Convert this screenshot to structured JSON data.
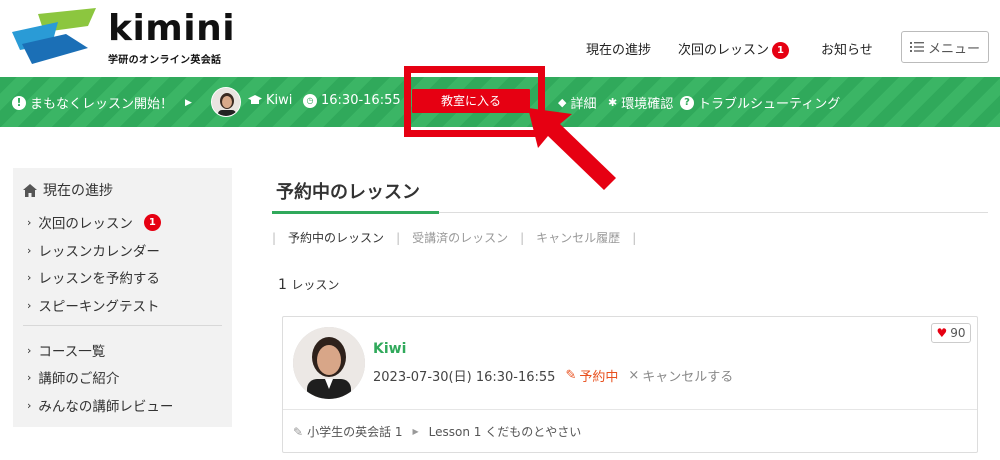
{
  "header": {
    "logo_word": "kimini",
    "logo_sub": "学研のオンライン英会話",
    "nav": [
      {
        "label": "現在の進捗"
      },
      {
        "label": "次回のレッスン",
        "badge": "1"
      },
      {
        "label": "お知らせ"
      }
    ],
    "menu_label": "メニュー"
  },
  "bar": {
    "notice": "まもなくレッスン開始！",
    "teacher": "Kiwi",
    "time": "16:30-16:55",
    "enter_label": "教室に入る",
    "links": [
      "詳細",
      "環境確認",
      "トラブルシューティング"
    ]
  },
  "sidebar": {
    "heading": "現在の進捗",
    "items": [
      {
        "label": "次回のレッスン",
        "badge": "1"
      },
      {
        "label": "レッスンカレンダー"
      },
      {
        "label": "レッスンを予約する"
      },
      {
        "label": "スピーキングテスト"
      },
      {
        "label": "コース一覧"
      },
      {
        "label": "講師のご紹介"
      },
      {
        "label": "みんなの講師レビュー"
      }
    ]
  },
  "main": {
    "title": "予約中のレッスン",
    "tabs": [
      "予約中のレッスン",
      "受講済のレッスン",
      "キャンセル履歴"
    ],
    "count_number": "1",
    "count_unit": "レッスン",
    "card": {
      "teacher": "Kiwi",
      "datetime": "2023-07-30(日) 16:30-16:55",
      "status": "予約中",
      "cancel": "キャンセルする",
      "favorites": "90",
      "course": "小学生の英会話 1",
      "lesson": "Lesson 1 くだものとやさい"
    }
  },
  "colors": {
    "brand_green": "#30a95b",
    "accent_red": "#e60012",
    "status_orange": "#e8501e"
  }
}
